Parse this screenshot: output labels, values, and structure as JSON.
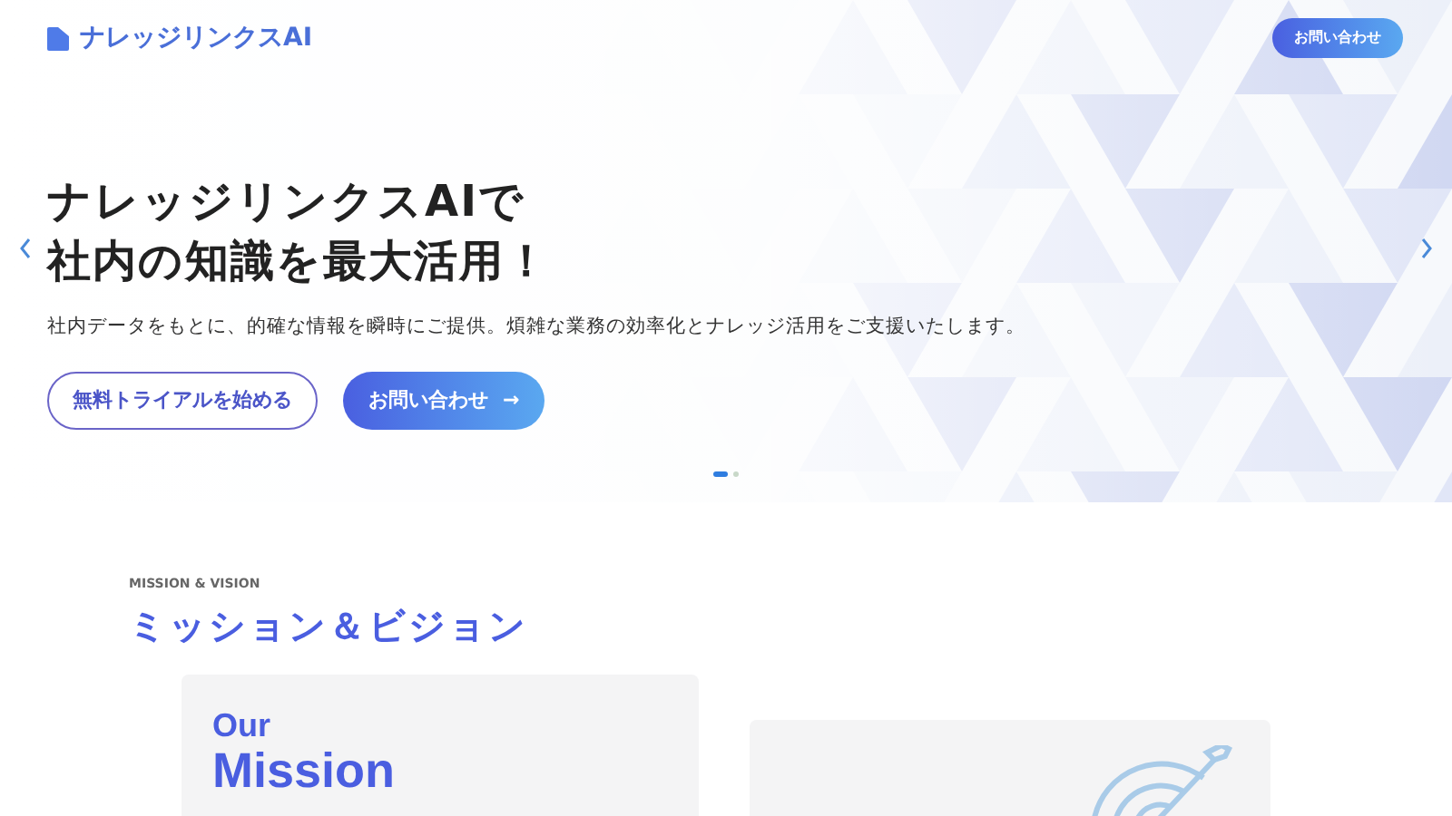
{
  "header": {
    "logo_text": "ナレッジリンクスAI",
    "contact_button": "お問い合わせ"
  },
  "hero": {
    "title_lines": [
      "ナレッジリンクスAIで",
      "社内の知識を最大活用！"
    ],
    "description": "社内データをもとに、的確な情報を瞬時にご提供。煩雑な業務の効率化とナレッジ活用をご支援いたします。",
    "buttons": [
      {
        "kind": "outline",
        "label": "無料トライアルを始める"
      },
      {
        "kind": "primary",
        "label": "お問い合わせ",
        "arrow": "→"
      }
    ],
    "slides": [
      {
        "selected": true
      },
      {
        "selected": false
      }
    ]
  },
  "section": {
    "eyebrow": "MISSION & VISION",
    "heading": "ミッション＆ビジョン",
    "mission_card": {
      "line_1": "Our",
      "line_2": "Mission"
    }
  }
}
